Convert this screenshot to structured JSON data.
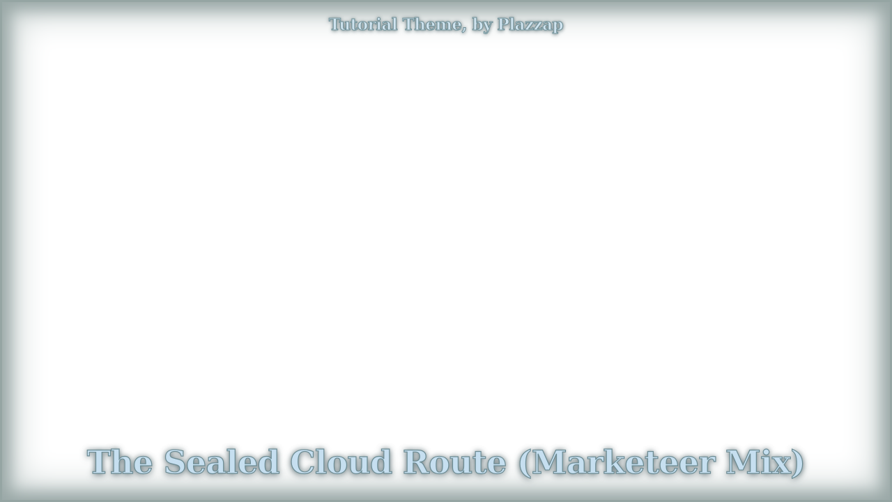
{
  "overlay": {
    "subtitle": "Tutorial Theme, by Plazzap",
    "title": "The Sealed Cloud Route (Marketeer Mix)"
  },
  "colors": {
    "background": "#ffffff",
    "border": "#95a5a3",
    "text_fill": "#c6dff0",
    "text_outline": "#6c8b93"
  }
}
